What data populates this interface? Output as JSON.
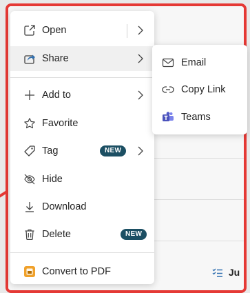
{
  "menu": {
    "items": [
      {
        "label": "Open",
        "icon": "open-in-new-icon"
      },
      {
        "label": "Share",
        "icon": "share-icon"
      },
      {
        "label": "Add to",
        "icon": "plus-icon"
      },
      {
        "label": "Favorite",
        "icon": "star-icon"
      },
      {
        "label": "Tag",
        "icon": "tag-icon",
        "badge": "NEW"
      },
      {
        "label": "Hide",
        "icon": "eye-off-icon"
      },
      {
        "label": "Download",
        "icon": "download-icon"
      },
      {
        "label": "Delete",
        "icon": "trash-icon",
        "badge": "NEW"
      },
      {
        "label": "Convert to PDF",
        "icon": "pdf-icon"
      }
    ]
  },
  "submenu": {
    "items": [
      {
        "label": "Email",
        "icon": "mail-icon"
      },
      {
        "label": "Copy Link",
        "icon": "link-icon"
      },
      {
        "label": "Teams",
        "icon": "teams-icon"
      }
    ]
  },
  "background": {
    "partial_text": "Ju"
  },
  "colors": {
    "highlight_frame": "#e53935",
    "badge": "#1c4f63",
    "share_icon_accent": "#2f6fb0",
    "pdf_icon": "#f0a12b",
    "teams_icon": "#5059c9"
  }
}
